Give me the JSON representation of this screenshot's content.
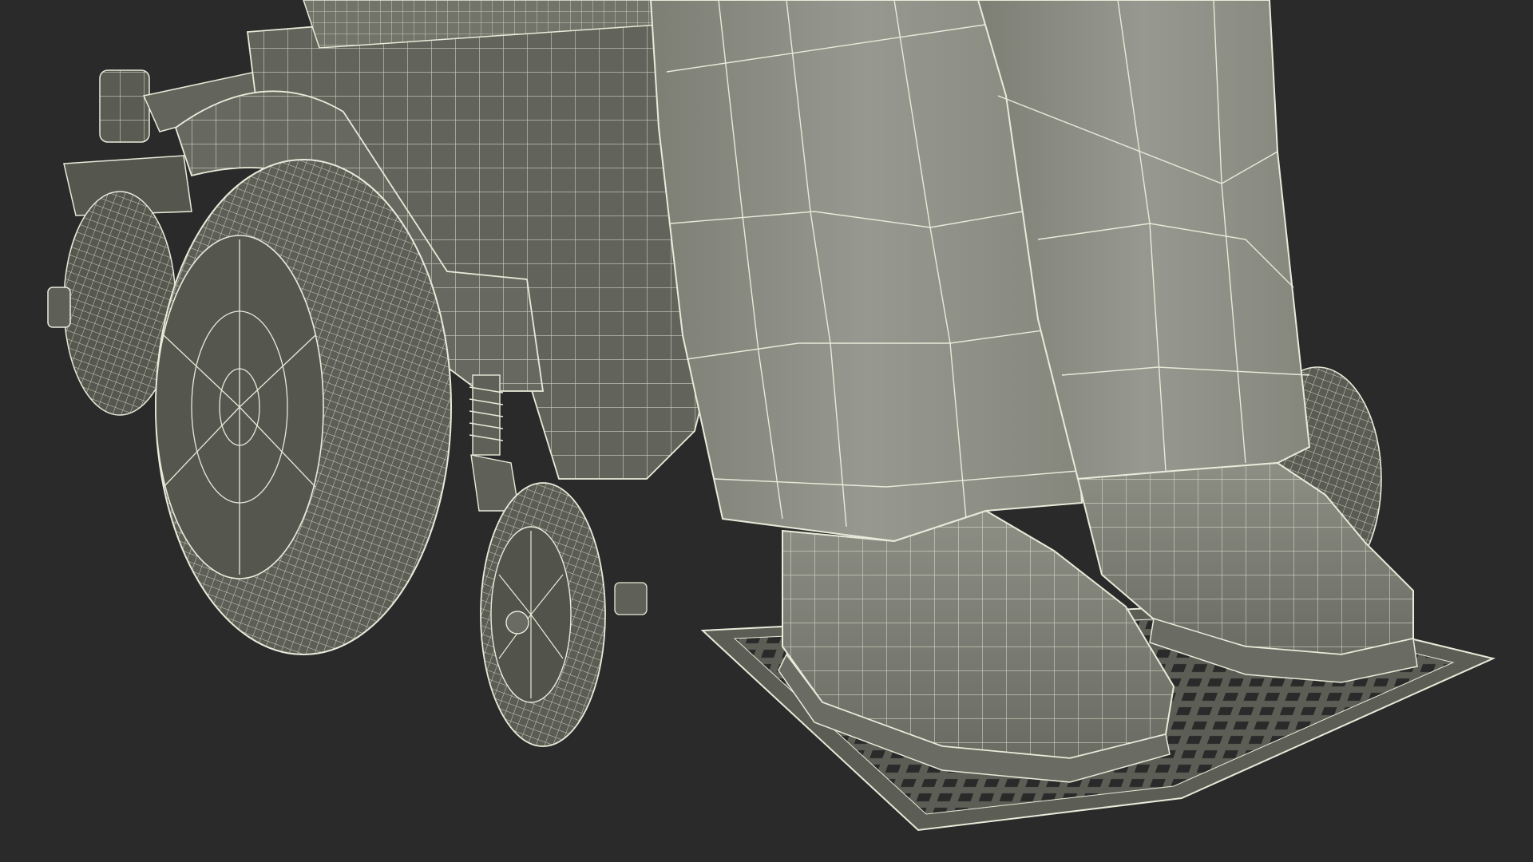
{
  "scene": {
    "subject": "wireframe-render-power-wheelchair-with-legs",
    "colors": {
      "background": "#2a2a2a",
      "surface_light": "#8c8e83",
      "surface_mid": "#6e7066",
      "surface_dark": "#4d4f47",
      "wire": "#e9ead9"
    }
  }
}
